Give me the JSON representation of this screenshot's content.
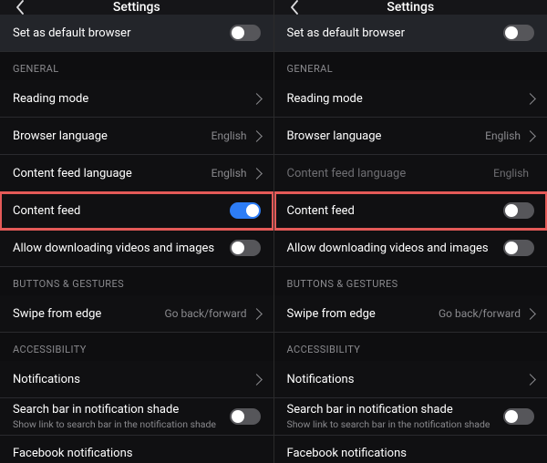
{
  "header": {
    "title": "Settings"
  },
  "labels": {
    "default_browser": "Set as default browser",
    "reading_mode": "Reading mode",
    "browser_language": "Browser language",
    "content_feed_language": "Content feed language",
    "content_feed": "Content feed",
    "allow_download": "Allow downloading videos and images",
    "swipe_from_edge": "Swipe from edge",
    "notifications": "Notifications",
    "search_bar_shade": "Search bar in notification shade",
    "search_bar_shade_sub": "Show link to search bar in the notification shade",
    "facebook_notifications": "Facebook notifications"
  },
  "sections": {
    "general": "GENERAL",
    "buttons_gestures": "BUTTONS & GESTURES",
    "accessibility": "ACCESSIBILITY"
  },
  "values": {
    "browser_language": "English",
    "content_feed_language": "English",
    "swipe_from_edge": "Go back/forward"
  },
  "left": {
    "default_browser_on": false,
    "content_feed_on": true,
    "allow_download_on": false,
    "search_bar_shade_on": false
  },
  "right": {
    "default_browser_on": false,
    "content_feed_on": false,
    "allow_download_on": false,
    "search_bar_shade_on": false,
    "content_feed_language_disabled": true
  }
}
